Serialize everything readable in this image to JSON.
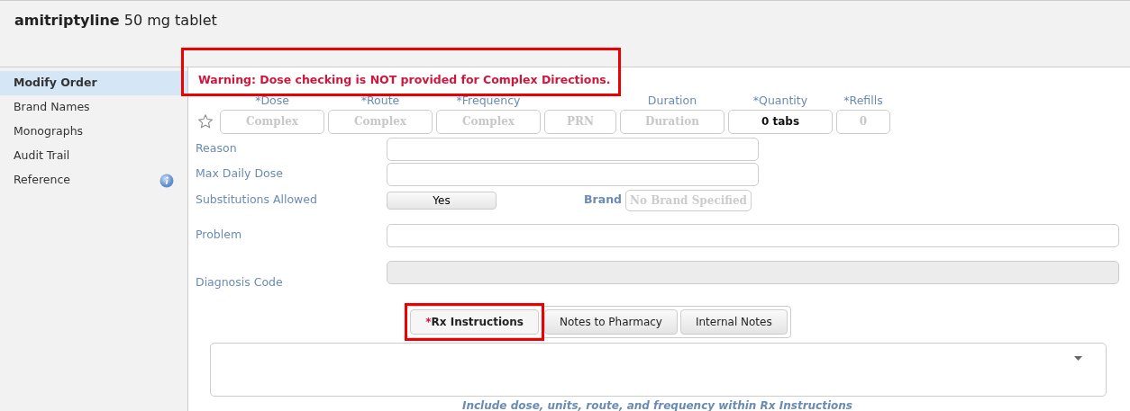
{
  "header": {
    "drug": "amitriptyline",
    "strength": "50 mg tablet"
  },
  "sidebar": {
    "items": [
      {
        "label": "Modify Order",
        "selected": true,
        "info": false
      },
      {
        "label": "Brand Names",
        "selected": false,
        "info": false
      },
      {
        "label": "Monographs",
        "selected": false,
        "info": false
      },
      {
        "label": "Audit Trail",
        "selected": false,
        "info": false
      },
      {
        "label": "Reference",
        "selected": false,
        "info": true
      }
    ]
  },
  "warning": {
    "text": "Warning: Dose checking is NOT provided for Complex Directions.",
    "highlighted": true
  },
  "order_fields": [
    {
      "label": "*Dose",
      "value": "Complex",
      "disabled": true
    },
    {
      "label": "*Route",
      "value": "Complex",
      "disabled": true
    },
    {
      "label": "*Frequency",
      "value": "Complex",
      "disabled": true
    },
    {
      "value": "PRN",
      "disabled": true
    },
    {
      "label": "Duration",
      "value": "Duration",
      "disabled": true
    },
    {
      "label": "*Quantity",
      "value": "0 tabs",
      "disabled": false
    },
    {
      "label": "*Refills",
      "value": "0",
      "disabled": true
    }
  ],
  "form": {
    "reason": {
      "label": "Reason"
    },
    "max_daily_dose": {
      "label": "Max Daily Dose"
    },
    "substitutions": {
      "label": "Substitutions Allowed",
      "value": "Yes"
    },
    "brand": {
      "label": "Brand",
      "value": "No Brand Specified"
    },
    "problem": {
      "label": "Problem"
    },
    "diagnosis_code": {
      "label": "Diagnosis Code",
      "disabled": true
    }
  },
  "note_tabs": [
    {
      "marker": "*",
      "label": "Rx Instructions",
      "selected": true,
      "highlighted": true
    },
    {
      "label": "Notes to Pharmacy",
      "selected": false,
      "highlighted": false
    },
    {
      "label": "Internal Notes",
      "selected": false,
      "highlighted": false
    }
  ],
  "hint": "Include dose, units, route, and frequency within Rx Instructions"
}
